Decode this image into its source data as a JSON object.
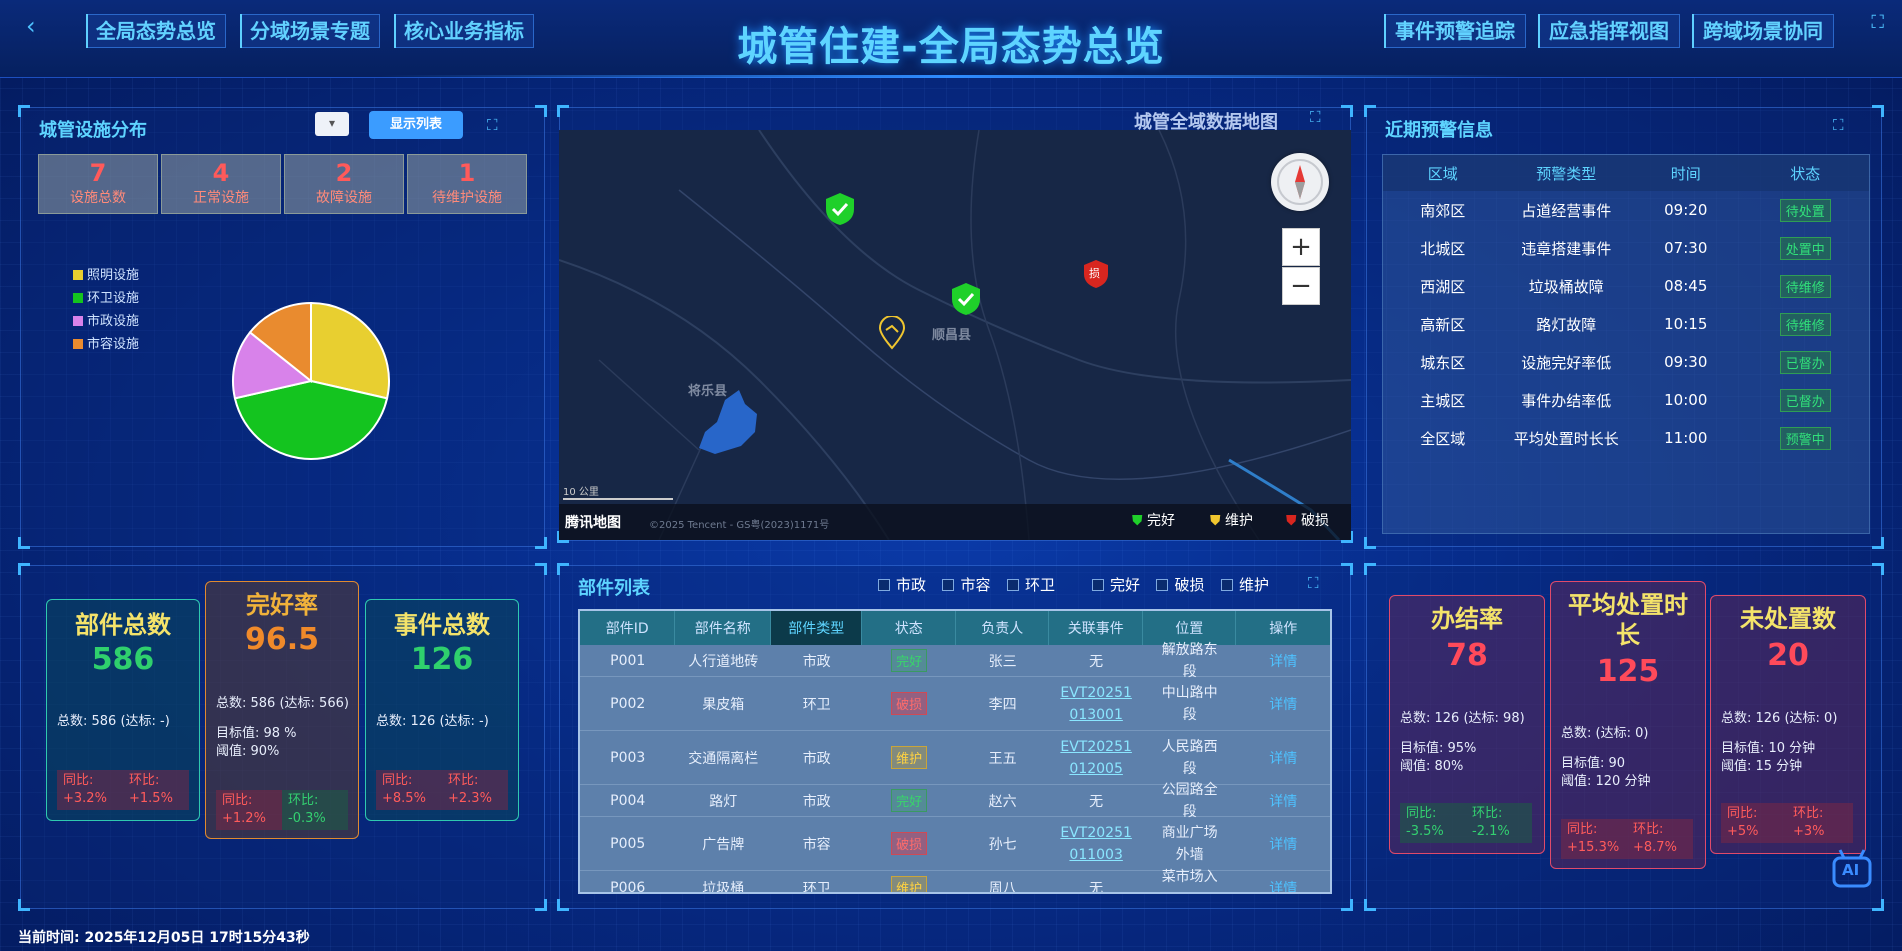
{
  "header": {
    "title": "城管住建-全局态势总览",
    "nav_left": [
      "全局态势总览",
      "分域场景专题",
      "核心业务指标"
    ],
    "nav_right": [
      "事件预警追踪",
      "应急指挥视图",
      "跨域场景协同"
    ]
  },
  "facility": {
    "title": "城管设施分布",
    "show_list": "显示列表",
    "stats": [
      {
        "value": "7",
        "label": "设施总数"
      },
      {
        "value": "4",
        "label": "正常设施"
      },
      {
        "value": "2",
        "label": "故障设施"
      },
      {
        "value": "1",
        "label": "待维护设施"
      }
    ],
    "chart_data": {
      "type": "pie",
      "categories": [
        "照明设施",
        "环卫设施",
        "市政设施",
        "市容设施"
      ],
      "values": [
        2,
        3,
        1,
        1
      ],
      "colors": [
        "#e8cf30",
        "#14c41f",
        "#d882ea",
        "#e98b2f"
      ],
      "legend": "top-left"
    }
  },
  "map": {
    "title": "城管全域数据地图",
    "place_labels": [
      "顺昌县",
      "将乐县"
    ],
    "scale": "10 公里",
    "brand": "腾讯地图",
    "copyright": "©2025 Tencent - GS粤(2023)1171号",
    "legend": [
      "完好",
      "维护",
      "破损"
    ],
    "zoom_in": "+",
    "zoom_out": "−",
    "marker_text": "损"
  },
  "alerts": {
    "title": "近期预警信息",
    "columns": [
      "区域",
      "预警类型",
      "时间",
      "状态"
    ],
    "rows": [
      [
        "南郊区",
        "占道经营事件",
        "09:20",
        "待处置"
      ],
      [
        "北城区",
        "违章搭建事件",
        "07:30",
        "处置中"
      ],
      [
        "西湖区",
        "垃圾桶故障",
        "08:45",
        "待维修"
      ],
      [
        "高新区",
        "路灯故障",
        "10:15",
        "待维修"
      ],
      [
        "城东区",
        "设施完好率低",
        "09:30",
        "已督办"
      ],
      [
        "主城区",
        "事件办结率低",
        "10:00",
        "已督办"
      ],
      [
        "全区域",
        "平均处置时长长",
        "11:00",
        "预警中"
      ]
    ]
  },
  "kpi_left": [
    {
      "title": "部件总数",
      "value": "586",
      "sub1": "总数: 586 (达标: -)",
      "yoy": "同比:",
      "yoy_v": "+3.2%",
      "mom": "环比:",
      "mom_v": "+1.5%"
    },
    {
      "title": "完好率",
      "value": "96.5",
      "sub1": "总数: 586 (达标: 566)",
      "target": "目标值:   98 %",
      "threshold": "阈值:   90%",
      "yoy": "同比:",
      "yoy_v": "+1.2%",
      "mom": "环比:",
      "mom_v": "-0.3%"
    },
    {
      "title": "事件总数",
      "value": "126",
      "sub1": "总数: 126 (达标: -)",
      "yoy": "同比:",
      "yoy_v": "+8.5%",
      "mom": "环比:",
      "mom_v": "+2.3%"
    }
  ],
  "parts": {
    "title": "部件列表",
    "filters_type": [
      "市政",
      "市容",
      "环卫"
    ],
    "filters_status": [
      "完好",
      "破损",
      "维护"
    ],
    "columns": [
      "部件ID",
      "部件名称",
      "部件类型",
      "状态",
      "负责人",
      "关联事件",
      "位置",
      "操作"
    ],
    "rows": [
      {
        "id": "P001",
        "name": "人行道地砖",
        "type": "市政",
        "status": "完好",
        "owner": "张三",
        "event": "无",
        "loc": "解放路东段",
        "op": "详情"
      },
      {
        "id": "P002",
        "name": "果皮箱",
        "type": "环卫",
        "status": "破损",
        "owner": "李四",
        "event": "EVT20251013001",
        "loc": "中山路中段",
        "op": "详情"
      },
      {
        "id": "P003",
        "name": "交通隔离栏",
        "type": "市政",
        "status": "维护",
        "owner": "王五",
        "event": "EVT20251012005",
        "loc": "人民路西段",
        "op": "详情"
      },
      {
        "id": "P004",
        "name": "路灯",
        "type": "市政",
        "status": "完好",
        "owner": "赵六",
        "event": "无",
        "loc": "公园路全段",
        "op": "详情"
      },
      {
        "id": "P005",
        "name": "广告牌",
        "type": "市容",
        "status": "破损",
        "owner": "孙七",
        "event": "EVT20251011003",
        "loc": "商业广场外墙",
        "op": "详情"
      },
      {
        "id": "P006",
        "name": "垃圾桶",
        "type": "环卫",
        "status": "维护",
        "owner": "周八",
        "event": "无",
        "loc": "菜市场入口",
        "op": "详情"
      }
    ]
  },
  "kpi_right": [
    {
      "title": "办结率",
      "value": "78",
      "sub1": "总数: 126 (达标: 98)",
      "target": "目标值:   95%",
      "threshold": "阈值:   80%",
      "yoy": "同比:",
      "yoy_v": "-3.5%",
      "mom": "环比:",
      "mom_v": "-2.1%"
    },
    {
      "title": "平均处置时长",
      "value": "125",
      "sub1": "总数: (达标: 0)",
      "target": "目标值:   90",
      "threshold": "阈值:   120 分钟",
      "yoy": "同比:",
      "yoy_v": "+15.3%",
      "mom": "环比:",
      "mom_v": "+8.7%"
    },
    {
      "title": "未处置数",
      "value": "20",
      "sub1": "总数: 126 (达标: 0)",
      "target": "目标值:   10 分钟",
      "threshold": "阈值:   15 分钟",
      "yoy": "同比:",
      "yoy_v": "+5%",
      "mom": "环比:",
      "mom_v": "+3%"
    }
  ],
  "footer": {
    "time": "当前时间: 2025年12月05日 17时15分43秒"
  },
  "ai_label": "AI"
}
